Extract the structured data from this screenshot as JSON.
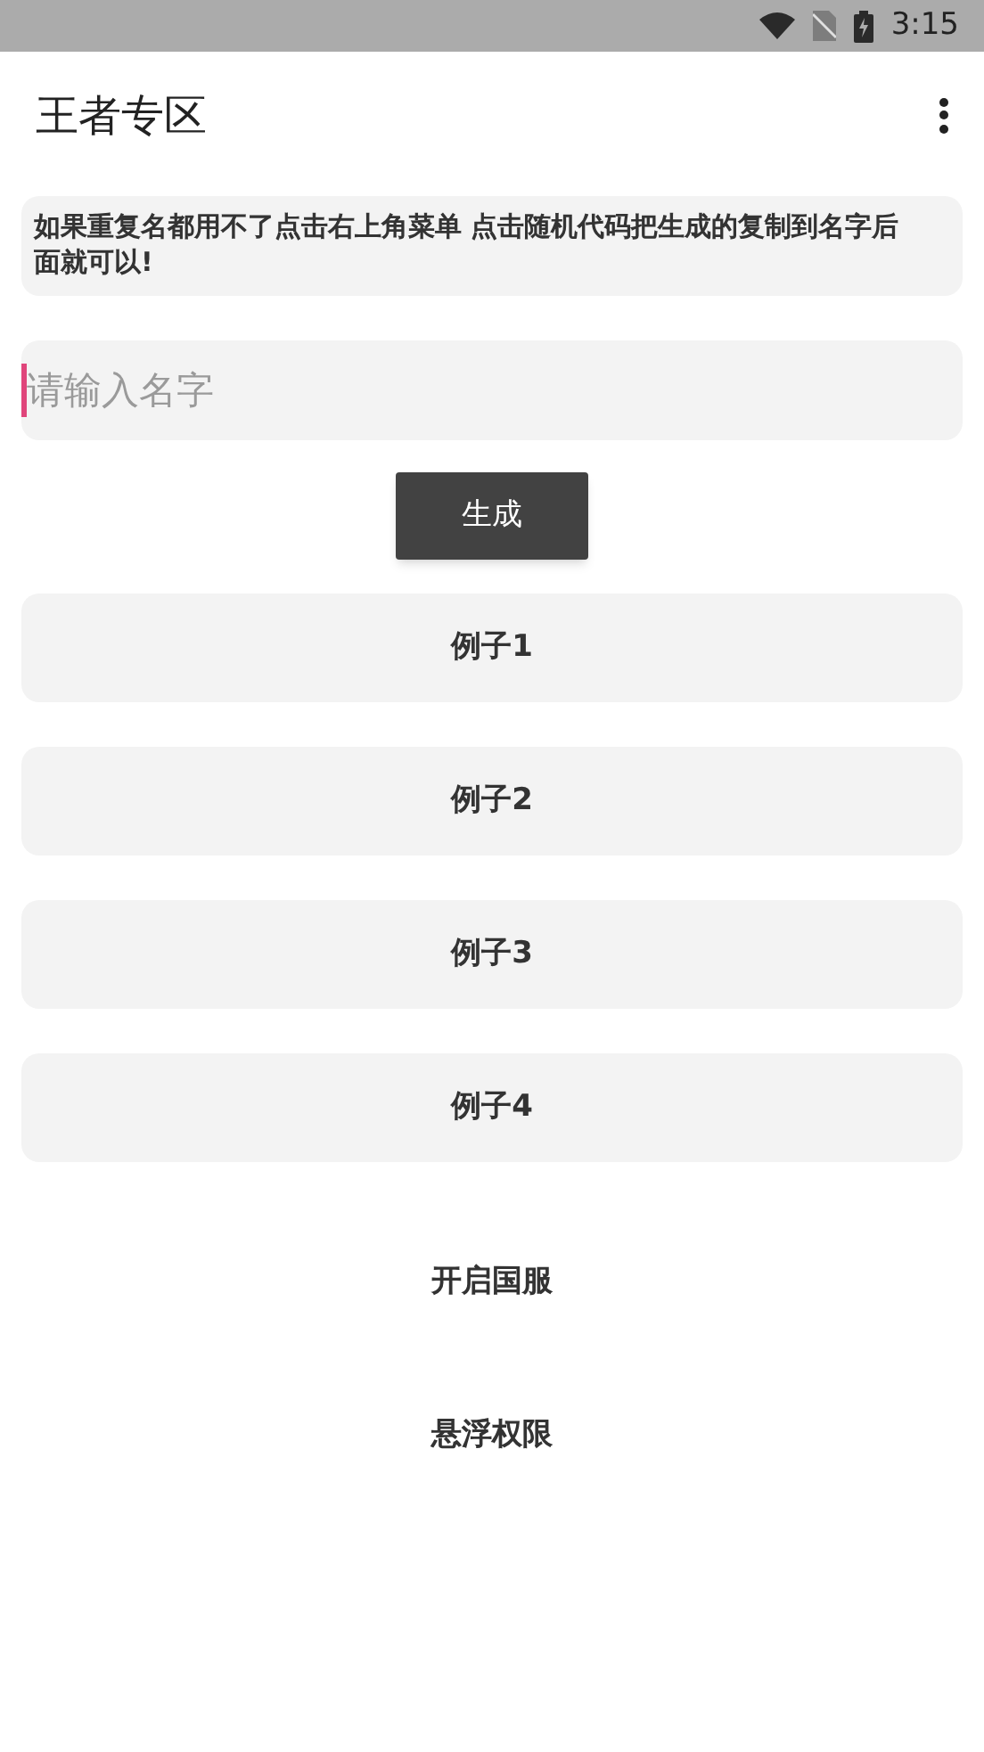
{
  "status_bar": {
    "time": "3:15"
  },
  "app_bar": {
    "title": "王者专区"
  },
  "notice": "如果重复名都用不了点击右上角菜单 点击随机代码把生成的复制到名字后面就可以!",
  "name_field": {
    "placeholder": "请输入名字",
    "focused": true
  },
  "generate_button": "生成",
  "actions": [
    {
      "label": "例子1",
      "kind": "card"
    },
    {
      "label": "例子2",
      "kind": "card"
    },
    {
      "label": "例子3",
      "kind": "card"
    },
    {
      "label": "例子4",
      "kind": "card"
    },
    {
      "label": "开启国服",
      "kind": "text"
    },
    {
      "label": "悬浮权限",
      "kind": "text"
    }
  ]
}
